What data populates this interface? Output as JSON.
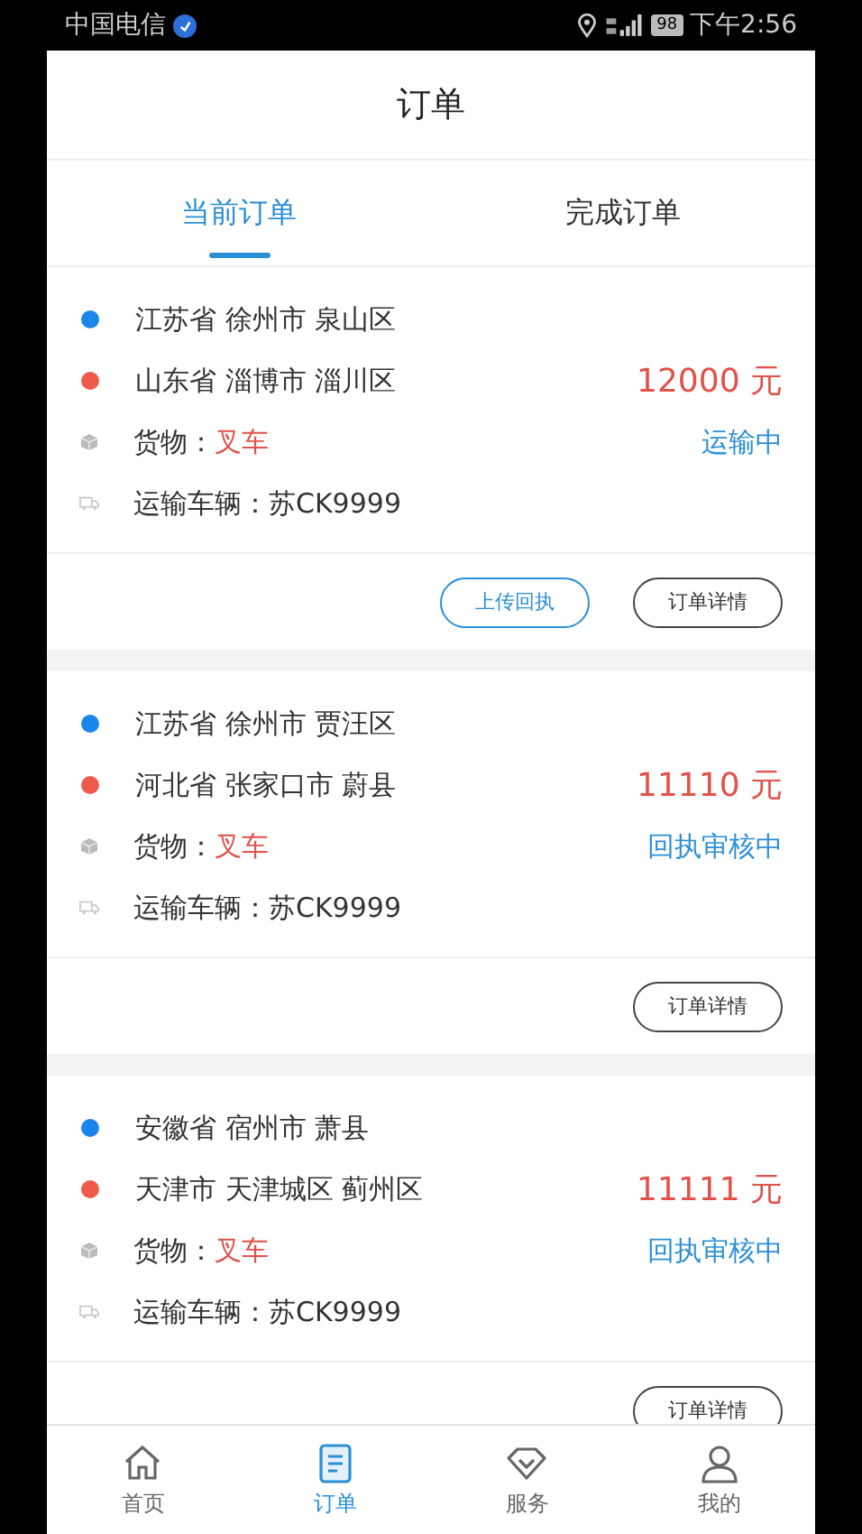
{
  "status_bar": {
    "carrier": "中国电信",
    "battery": "98",
    "time": "下午2:56"
  },
  "header": {
    "title": "订单"
  },
  "tabs": [
    {
      "label": "当前订单",
      "selected": true
    },
    {
      "label": "完成订单",
      "selected": false
    }
  ],
  "orders": [
    {
      "origin": "江苏省 徐州市 泉山区",
      "destination": "山东省 淄博市 淄川区",
      "price": "12000 元",
      "cargo_label": "货物：",
      "cargo": "叉车",
      "vehicle": "运输车辆：苏CK9999",
      "status": "运输中",
      "actions": [
        {
          "label": "上传回执",
          "kind": "primary"
        },
        {
          "label": "订单详情",
          "kind": "default"
        }
      ]
    },
    {
      "origin": "江苏省 徐州市 贾汪区",
      "destination": "河北省 张家口市 蔚县",
      "price": "11110 元",
      "cargo_label": "货物：",
      "cargo": "叉车",
      "vehicle": "运输车辆：苏CK9999",
      "status": "回执审核中",
      "actions": [
        {
          "label": "订单详情",
          "kind": "default"
        }
      ]
    },
    {
      "origin": "安徽省 宿州市 萧县",
      "destination": "天津市 天津城区 蓟州区",
      "price": "11111 元",
      "cargo_label": "货物：",
      "cargo": "叉车",
      "vehicle": "运输车辆：苏CK9999",
      "status": "回执审核中",
      "actions": [
        {
          "label": "订单详情",
          "kind": "default"
        }
      ]
    }
  ],
  "bottom_nav": [
    {
      "label": "首页",
      "kind": "home",
      "selected": false
    },
    {
      "label": "订单",
      "kind": "orders",
      "selected": true
    },
    {
      "label": "服务",
      "kind": "service",
      "selected": false
    },
    {
      "label": "我的",
      "kind": "profile",
      "selected": false
    }
  ]
}
